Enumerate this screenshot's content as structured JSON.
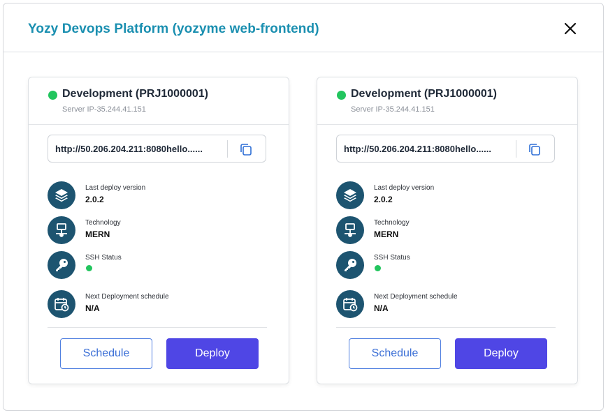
{
  "modal": {
    "title": "Yozy Devops Platform (yozyme web-frontend)",
    "accent_color": "#1a8fb0"
  },
  "cards": [
    {
      "status_color": "#22c55e",
      "title": "Development (PRJ1000001)",
      "server_ip": "Server IP-35.244.41.151",
      "url": "http://50.206.204.211:8080hello......",
      "items": [
        {
          "icon": "layers-icon",
          "label": "Last deploy version",
          "value": "2.0.2"
        },
        {
          "icon": "network-icon",
          "label": "Technology",
          "value": "MERN"
        },
        {
          "icon": "key-icon",
          "label": "SSH Status",
          "status_color": "#22c55e"
        },
        {
          "icon": "calendar-clock-icon",
          "label": "Next Deployment schedule",
          "value": "N/A"
        }
      ],
      "schedule_label": "Schedule",
      "deploy_label": "Deploy"
    },
    {
      "status_color": "#22c55e",
      "title": "Development (PRJ1000001)",
      "server_ip": "Server IP-35.244.41.151",
      "url": "http://50.206.204.211:8080hello......",
      "items": [
        {
          "icon": "layers-icon",
          "label": "Last deploy version",
          "value": "2.0.2"
        },
        {
          "icon": "network-icon",
          "label": "Technology",
          "value": "MERN"
        },
        {
          "icon": "key-icon",
          "label": "SSH Status",
          "status_color": "#22c55e"
        },
        {
          "icon": "calendar-clock-icon",
          "label": "Next Deployment schedule",
          "value": "N/A"
        }
      ],
      "schedule_label": "Schedule",
      "deploy_label": "Deploy"
    }
  ],
  "colors": {
    "icon_bg": "#1d5470",
    "deploy_button": "#4f46e5",
    "schedule_border": "#4f7fe0"
  }
}
